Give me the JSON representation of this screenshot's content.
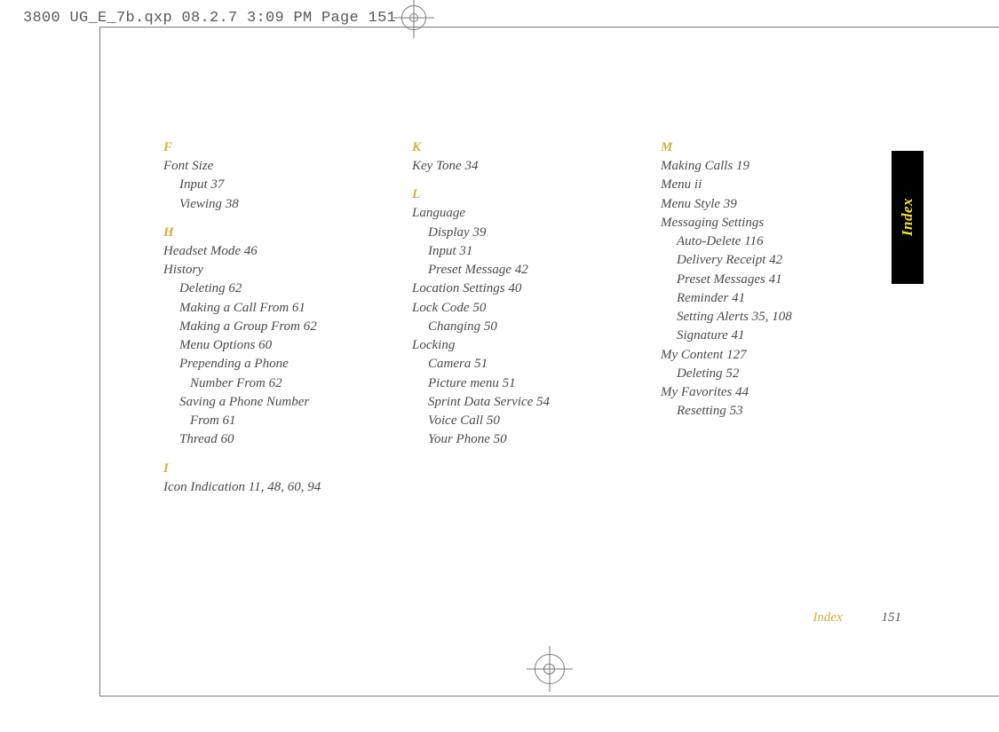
{
  "slug": "3800 UG_E_7b.qxp  08.2.7  3:09 PM  Page 151",
  "sideTab": "Index",
  "footer": {
    "section": "Index",
    "page": "151"
  },
  "col1": {
    "F": {
      "letter": "F",
      "fontSize": "Font Size",
      "fontSize_input": "Input  37",
      "fontSize_viewing": "Viewing  38"
    },
    "H": {
      "letter": "H",
      "headset": "Headset Mode  46",
      "history": "History",
      "history_deleting": "Deleting  62",
      "history_makingCall": "Making a Call From  61",
      "history_makingGroup": "Making a Group From  62",
      "history_menu": "Menu Options  60",
      "history_prepending1": "Prepending a Phone",
      "history_prepending2": "Number From  62",
      "history_saving1": "Saving a Phone Number",
      "history_saving2": "From  61",
      "history_thread": "Thread  60"
    },
    "I": {
      "letter": "I",
      "icon": "Icon Indication  11, 48, 60, 94"
    }
  },
  "col2": {
    "K": {
      "letter": "K",
      "keyTone": "Key Tone  34"
    },
    "L": {
      "letter": "L",
      "language": "Language",
      "language_display": "Display  39",
      "language_input": "Input  31",
      "language_preset": "Preset Message  42",
      "location": "Location Settings  40",
      "lockCode": "Lock Code  50",
      "lockCode_changing": "Changing  50",
      "locking": "Locking",
      "locking_camera": "Camera  51",
      "locking_picture": "Picture menu  51",
      "locking_sprint": "Sprint Data Service  54",
      "locking_voice": "Voice Call  50",
      "locking_phone": "Your Phone  50"
    }
  },
  "col3": {
    "M": {
      "letter": "M",
      "makingCalls": "Making Calls  19",
      "menu": "Menu  ii",
      "menuStyle": "Menu Style  39",
      "messaging": "Messaging Settings",
      "messaging_auto": "Auto-Delete  116",
      "messaging_delivery": "Delivery Receipt  42",
      "messaging_preset": "Preset Messages  41",
      "messaging_reminder": "Reminder  41",
      "messaging_alerts": "Setting Alerts  35, 108",
      "messaging_signature": "Signature  41",
      "myContent": "My Content  127",
      "myContent_deleting": "Deleting  52",
      "myFav": "My Favorites  44",
      "myFav_reset": "Resetting  53"
    }
  }
}
